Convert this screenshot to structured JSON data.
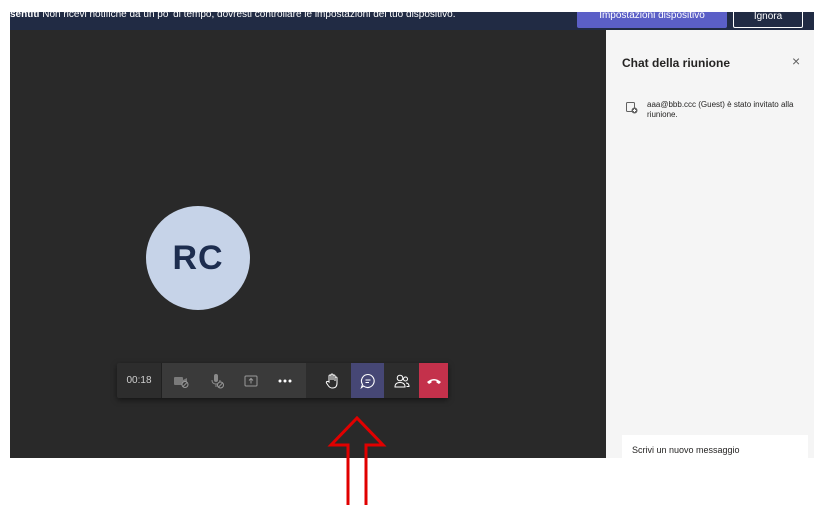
{
  "banner": {
    "bold_text": "sentiti",
    "message": " Non ricevi notifiche da un po' di tempo, dovresti controllare le impostazioni del tuo dispositivo.",
    "settings_button": "Impostazioni dispositivo",
    "ignore_button": "Ignora"
  },
  "participant": {
    "initials": "RC"
  },
  "toolbar": {
    "timer": "00:18"
  },
  "chat_panel": {
    "title": "Chat della riunione",
    "close_glyph": "×",
    "invite_message": "aaa@bbb.ccc (Guest) è stato invitato alla riunione.",
    "compose_placeholder": "Scrivi un nuovo messaggio"
  },
  "colors": {
    "meeting_background": "#292929",
    "banner": "#212b44",
    "accent": "#5b5fc7",
    "hangup": "#c4314b",
    "avatar": "#c6d3e8",
    "annotation_arrow": "#e00000"
  },
  "icons": {
    "camera_off": "camera-off-icon",
    "mic_off": "mic-off-icon",
    "share": "share-screen-icon",
    "more": "more-icon",
    "raise_hand": "raise-hand-icon",
    "chat": "chat-icon",
    "participants": "participants-icon",
    "hangup": "hang-up-icon",
    "invite": "invite-icon"
  }
}
